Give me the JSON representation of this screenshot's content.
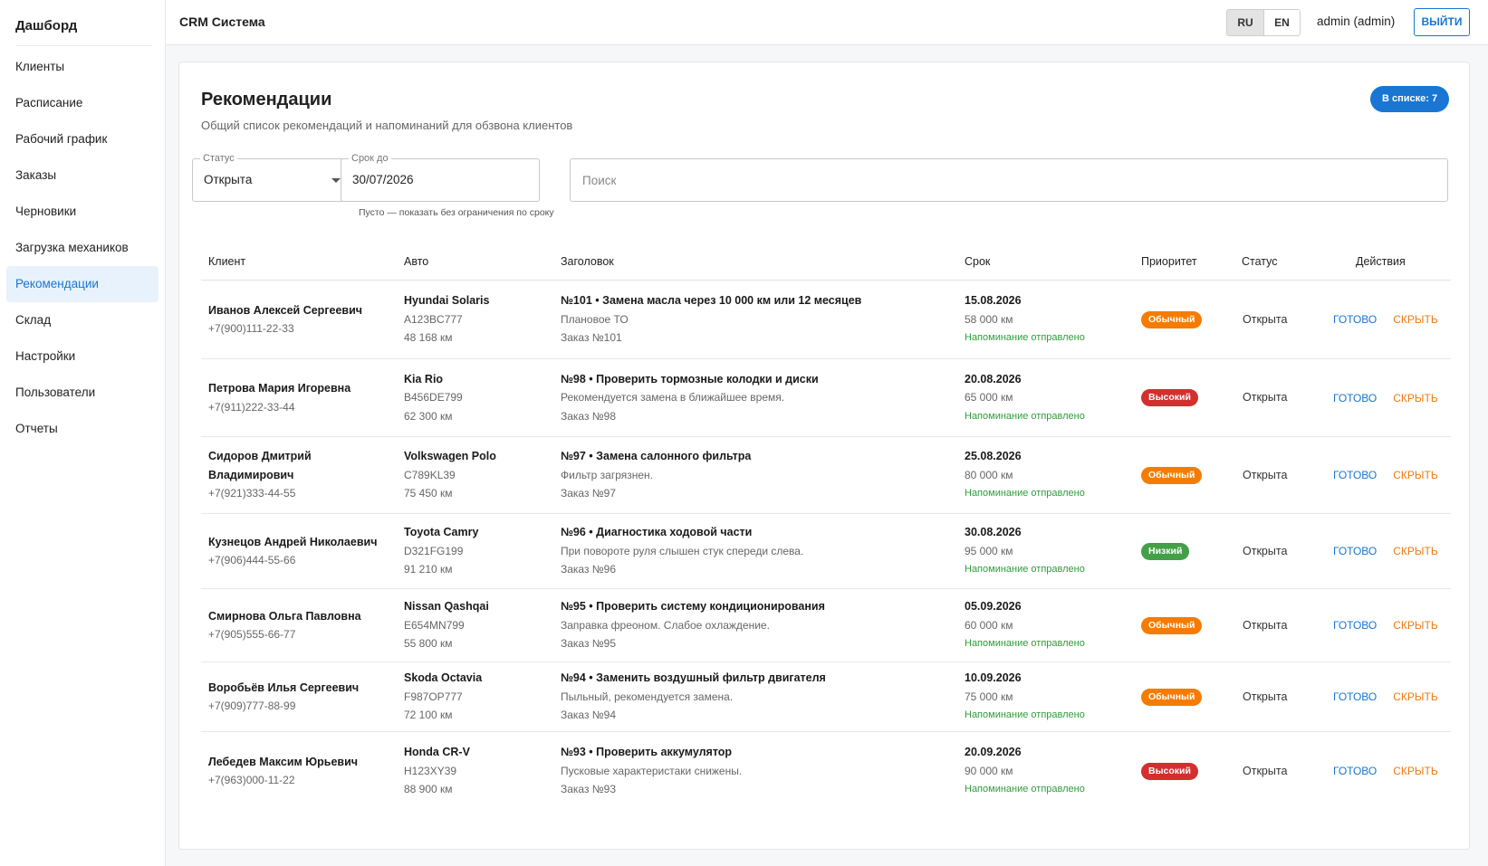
{
  "sidebar": {
    "title": "Дашборд",
    "items": [
      {
        "label": "Клиенты",
        "active": false
      },
      {
        "label": "Расписание",
        "active": false
      },
      {
        "label": "Рабочий график",
        "active": false
      },
      {
        "label": "Заказы",
        "active": false
      },
      {
        "label": "Черновики",
        "active": false
      },
      {
        "label": "Загрузка механиков",
        "active": false
      },
      {
        "label": "Рекомендации",
        "active": true
      },
      {
        "label": "Склад",
        "active": false
      },
      {
        "label": "Настройки",
        "active": false
      },
      {
        "label": "Пользователи",
        "active": false
      },
      {
        "label": "Отчеты",
        "active": false
      }
    ]
  },
  "header": {
    "app_title": "CRM Система",
    "lang_options": [
      "RU",
      "EN"
    ],
    "lang_selected": "RU",
    "user": "admin (admin)",
    "logout_label": "ВЫЙТИ"
  },
  "page": {
    "title": "Рекомендации",
    "subtitle": "Общий список рекомендаций и напоминаний для обзвона клиентов",
    "count_badge": "В списке: 7"
  },
  "filters": {
    "status_label": "Статус",
    "status_value": "Открыта",
    "due_label": "Срок до",
    "due_value": "30/07/2026",
    "due_helper": "Пусто — показать без ограничения по сроку",
    "search_placeholder": "Поиск",
    "search_value": ""
  },
  "table": {
    "columns": [
      "Клиент",
      "Авто",
      "Заголовок",
      "Срок",
      "Приоритет",
      "Статус",
      "Действия"
    ],
    "action_done": "ГОТОВО",
    "action_hide": "СКРЫТЬ",
    "rows": [
      {
        "client_lines": [
          "Иванов Алексей Сергеевич"
        ],
        "phone": "+7(900)111-22-33",
        "car": "Hyundai Solaris",
        "plate": "A123BC777",
        "mileage": "48 168 км",
        "title": "№101 • Замена масла через 10 000 км или 12 месяцев",
        "desc": "Плановое ТО",
        "order": "Заказ №101",
        "due_date": "15.08.2026",
        "due_km": "58 000 км",
        "reminder": "Напоминание отправлено",
        "priority": "Обычный",
        "priority_color": "#f57c00",
        "status": "Открыта"
      },
      {
        "client_lines": [
          "Петрова Мария Игоревна"
        ],
        "phone": "+7(911)222-33-44",
        "car": "Kia Rio",
        "plate": "B456DE799",
        "mileage": "62 300 км",
        "title": "№98 • Проверить тормозные колодки и диски",
        "desc": "Рекомендуется замена в ближайшее время.",
        "order": "Заказ №98",
        "due_date": "20.08.2026",
        "due_km": "65 000 км",
        "reminder": "Напоминание отправлено",
        "priority": "Высокий",
        "priority_color": "#d32f2f",
        "status": "Открыта"
      },
      {
        "client_lines": [
          "Сидоров Дмитрий",
          "Владимирович"
        ],
        "phone": "+7(921)333-44-55",
        "car": "Volkswagen Polo",
        "plate": "C789KL39",
        "mileage": "75 450 км",
        "title": "№97 • Замена салонного фильтра",
        "desc": "Фильтр загрязнен.",
        "order": "Заказ №97",
        "due_date": "25.08.2026",
        "due_km": "80 000 км",
        "reminder": "Напоминание отправлено",
        "priority": "Обычный",
        "priority_color": "#f57c00",
        "status": "Открыта"
      },
      {
        "client_lines": [
          "Кузнецов Андрей Николаевич"
        ],
        "phone": "+7(906)444-55-66",
        "car": "Toyota Camry",
        "plate": "D321FG199",
        "mileage": "91 210 км",
        "title": "№96 • Диагностика ходовой части",
        "desc": "При повороте руля слышен стук спереди слева.",
        "order": "Заказ №96",
        "due_date": "30.08.2026",
        "due_km": "95 000 км",
        "reminder": "Напоминание отправлено",
        "priority": "Низкий",
        "priority_color": "#43a047",
        "status": "Открыта"
      },
      {
        "client_lines": [
          "Смирнова Ольга Павловна"
        ],
        "phone": "+7(905)555-66-77",
        "car": "Nissan Qashqai",
        "plate": "E654MN799",
        "mileage": "55 800 км",
        "title": "№95 • Проверить систему кондиционирования",
        "desc": "Заправка фреоном. Слабое охлаждение.",
        "order": "Заказ №95",
        "due_date": "05.09.2026",
        "due_km": "60 000 км",
        "reminder": "Напоминание отправлено",
        "priority": "Обычный",
        "priority_color": "#f57c00",
        "status": "Открыта"
      },
      {
        "client_lines": [
          "Воробьёв Илья Сергеевич"
        ],
        "phone": "+7(909)777-88-99",
        "car": "Skoda Octavia",
        "plate": "F987OP777",
        "mileage": "72 100 км",
        "title": "№94 • Заменить воздушный фильтр двигателя",
        "desc": "Пыльный, рекомендуется замена.",
        "order": "Заказ №94",
        "due_date": "10.09.2026",
        "due_km": "75 000 км",
        "reminder": "Напоминание отправлено",
        "priority": "Обычный",
        "priority_color": "#f57c00",
        "status": "Открыта"
      },
      {
        "client_lines": [
          "Лебедев Максим Юрьевич"
        ],
        "phone": "+7(963)000-11-22",
        "car": "Honda CR-V",
        "plate": "H123XY39",
        "mileage": "88 900 км",
        "title": "№93 • Проверить аккумулятор",
        "desc": "Пусковые характеристаки снижены.",
        "order": "Заказ №93",
        "due_date": "20.09.2026",
        "due_km": "90 000 км",
        "reminder": "Напоминание отправлено",
        "priority": "Высокий",
        "priority_color": "#d32f2f",
        "status": "Открыта"
      }
    ]
  }
}
